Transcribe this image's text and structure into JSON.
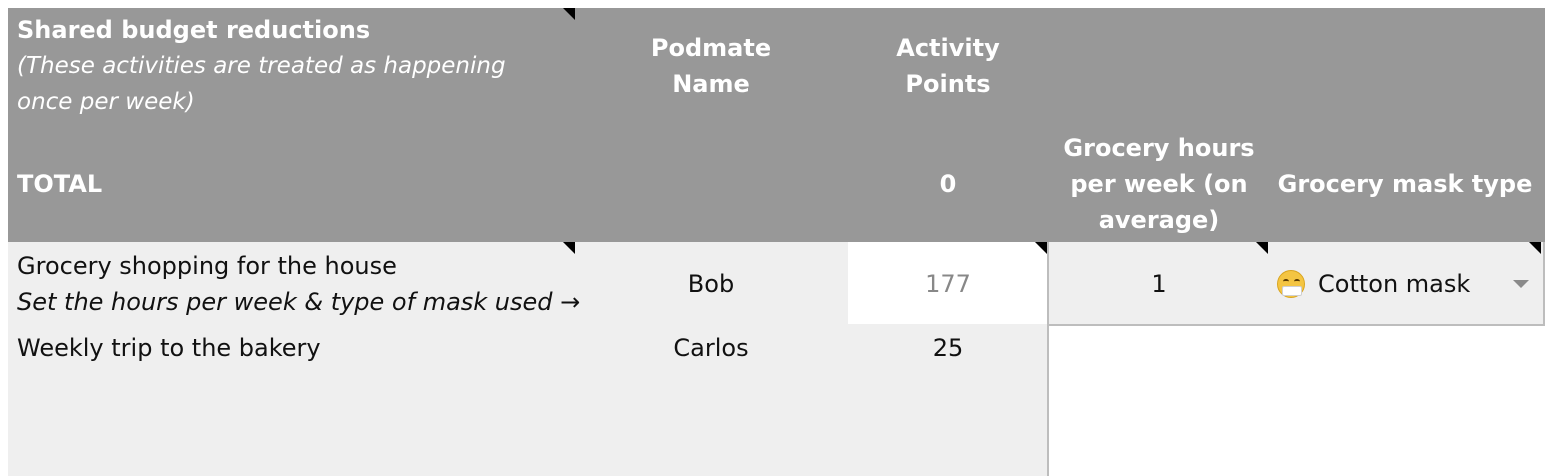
{
  "header": {
    "section_title": "Shared budget reductions",
    "section_subtitle_line1": "(These activities are treated as happening",
    "section_subtitle_line2": "once per week)",
    "total_label": "TOTAL",
    "podmate_line1": "Podmate",
    "podmate_line2": "Name",
    "points_line1": "Activity",
    "points_line2": "Points",
    "total_points": "0",
    "grocery_hours_line1": "Grocery hours",
    "grocery_hours_line2": "per week (on",
    "grocery_hours_line3": "average)",
    "grocery_mask_label": "Grocery mask type"
  },
  "rows": [
    {
      "activity": "Grocery shopping for the house",
      "activity_note": "Set the hours per week & type of mask used →",
      "podmate": "Bob",
      "points": "177",
      "hours": "1",
      "mask_icon": "face-with-medical-mask-icon",
      "mask": "Cotton mask"
    },
    {
      "activity": "Weekly trip to the bakery",
      "podmate": "Carlos",
      "points": "25"
    }
  ],
  "colors": {
    "header_bg": "#989898",
    "cell_bg": "#efefef",
    "muted_text": "#888888"
  }
}
